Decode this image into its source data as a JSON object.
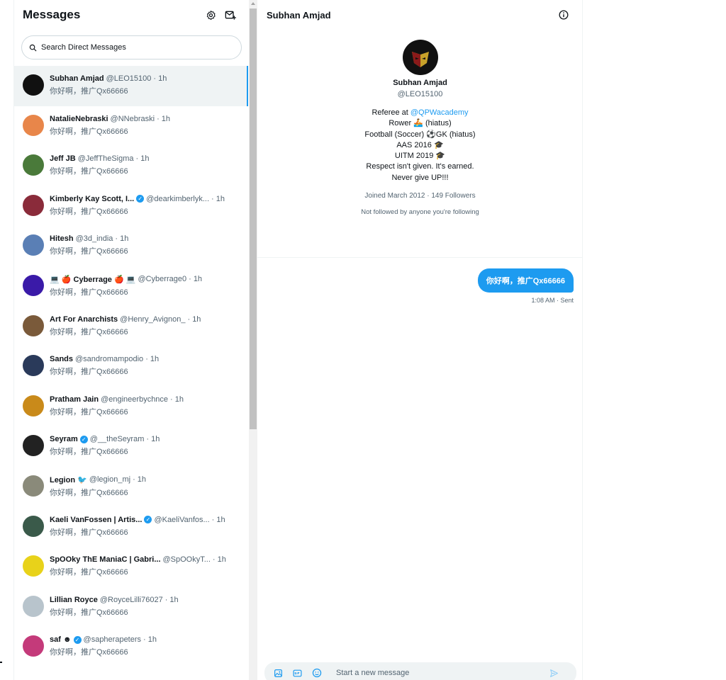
{
  "inbox": {
    "title": "Messages",
    "search_placeholder": "Search Direct Messages",
    "conversations": [
      {
        "name": "Subhan Amjad",
        "verified": false,
        "handle": "@LEO15100",
        "time": "· 1h",
        "preview": "你好啊，推广Qx66666",
        "avatar_color": "#111111"
      },
      {
        "name": "NatalieNebraski",
        "verified": false,
        "handle": "@NNebraski",
        "time": "· 1h",
        "preview": "你好啊，推广Qx66666",
        "avatar_color": "#e8864a"
      },
      {
        "name": "Jeff JB",
        "verified": false,
        "handle": "@JeffTheSigma",
        "time": "· 1h",
        "preview": "你好啊，推广Qx66666",
        "avatar_color": "#4a7a3a"
      },
      {
        "name": "Kimberly Kay Scott, I...",
        "verified": true,
        "handle": "@dearkimberlyk...",
        "time": "· 1h",
        "preview": "你好啊，推广Qx66666",
        "avatar_color": "#8a2b3a"
      },
      {
        "name": "Hitesh",
        "verified": false,
        "handle": "@3d_india",
        "time": "· 1h",
        "preview": "你好啊，推广Qx66666",
        "avatar_color": "#5a7fb5"
      },
      {
        "name": "💻 🍎 Cyberrage 🍎 💻",
        "verified": false,
        "handle": "@Cyberrage0",
        "time": "· 1h",
        "preview": "你好啊，推广Qx66666",
        "avatar_color": "#3a1aa8"
      },
      {
        "name": "Art For Anarchists",
        "verified": false,
        "handle": "@Henry_Avignon_",
        "time": "· 1h",
        "preview": "你好啊，推广Qx66666",
        "avatar_color": "#7a5a3a"
      },
      {
        "name": "Sands",
        "verified": false,
        "handle": "@sandromampodio",
        "time": "· 1h",
        "preview": "你好啊，推广Qx66666",
        "avatar_color": "#2a3a5a"
      },
      {
        "name": "Pratham Jain",
        "verified": false,
        "handle": "@engineerbychnce",
        "time": "· 1h",
        "preview": "你好啊，推广Qx66666",
        "avatar_color": "#c98a1a"
      },
      {
        "name": "Seyram",
        "verified": true,
        "handle": "@__theSeyram",
        "time": "· 1h",
        "preview": "你好啊，推广Qx66666",
        "avatar_color": "#222222"
      },
      {
        "name": "Legion 🐦",
        "verified": false,
        "handle": "@legion_mj",
        "time": "· 1h",
        "preview": "你好啊，推广Qx66666",
        "avatar_color": "#8a8a7a"
      },
      {
        "name": "Kaeli VanFossen | Artis...",
        "verified": true,
        "handle": "@KaeliVanfos...",
        "time": "· 1h",
        "preview": "你好啊，推广Qx66666",
        "avatar_color": "#3a5a4a"
      },
      {
        "name": "SpOOky ThE ManiaC | Gabri...",
        "verified": false,
        "handle": "@SpOOkyT...",
        "time": "· 1h",
        "preview": "你好啊，推广Qx66666",
        "avatar_color": "#e8d21a"
      },
      {
        "name": "Lillian Royce",
        "verified": false,
        "handle": "@RoyceLilli76027",
        "time": "· 1h",
        "preview": "你好啊，推广Qx66666",
        "avatar_color": "#b8c4cc"
      },
      {
        "name": "saf ☻",
        "verified": true,
        "handle": "@sapherapeters",
        "time": "· 1h",
        "preview": "你好啊，推广Qx66666",
        "avatar_color": "#c43a7a"
      }
    ]
  },
  "chat": {
    "title": "Subhan Amjad",
    "profile": {
      "name": "Subhan Amjad",
      "handle": "@LEO15100",
      "bio_prefix": "Referee at ",
      "bio_mention": "@QPWacademy",
      "bio_lines": [
        "Rower 🚣 (hiatus)",
        "Football (Soccer) ⚽GK (hiatus)",
        "AAS 2016 🎓",
        "UITM 2019 🎓",
        "Respect isn't given. It's earned.",
        "Never give UP!!!"
      ],
      "meta": "Joined March 2012 · 149 Followers",
      "note": "Not followed by anyone you're following"
    },
    "message": {
      "text": "你好啊，推广Qx66666",
      "meta": "1:08 AM · Sent"
    },
    "composer_placeholder": "Start a new message"
  },
  "colors": {
    "accent": "#1d9bf0",
    "active_bg": "#eff3f4"
  }
}
